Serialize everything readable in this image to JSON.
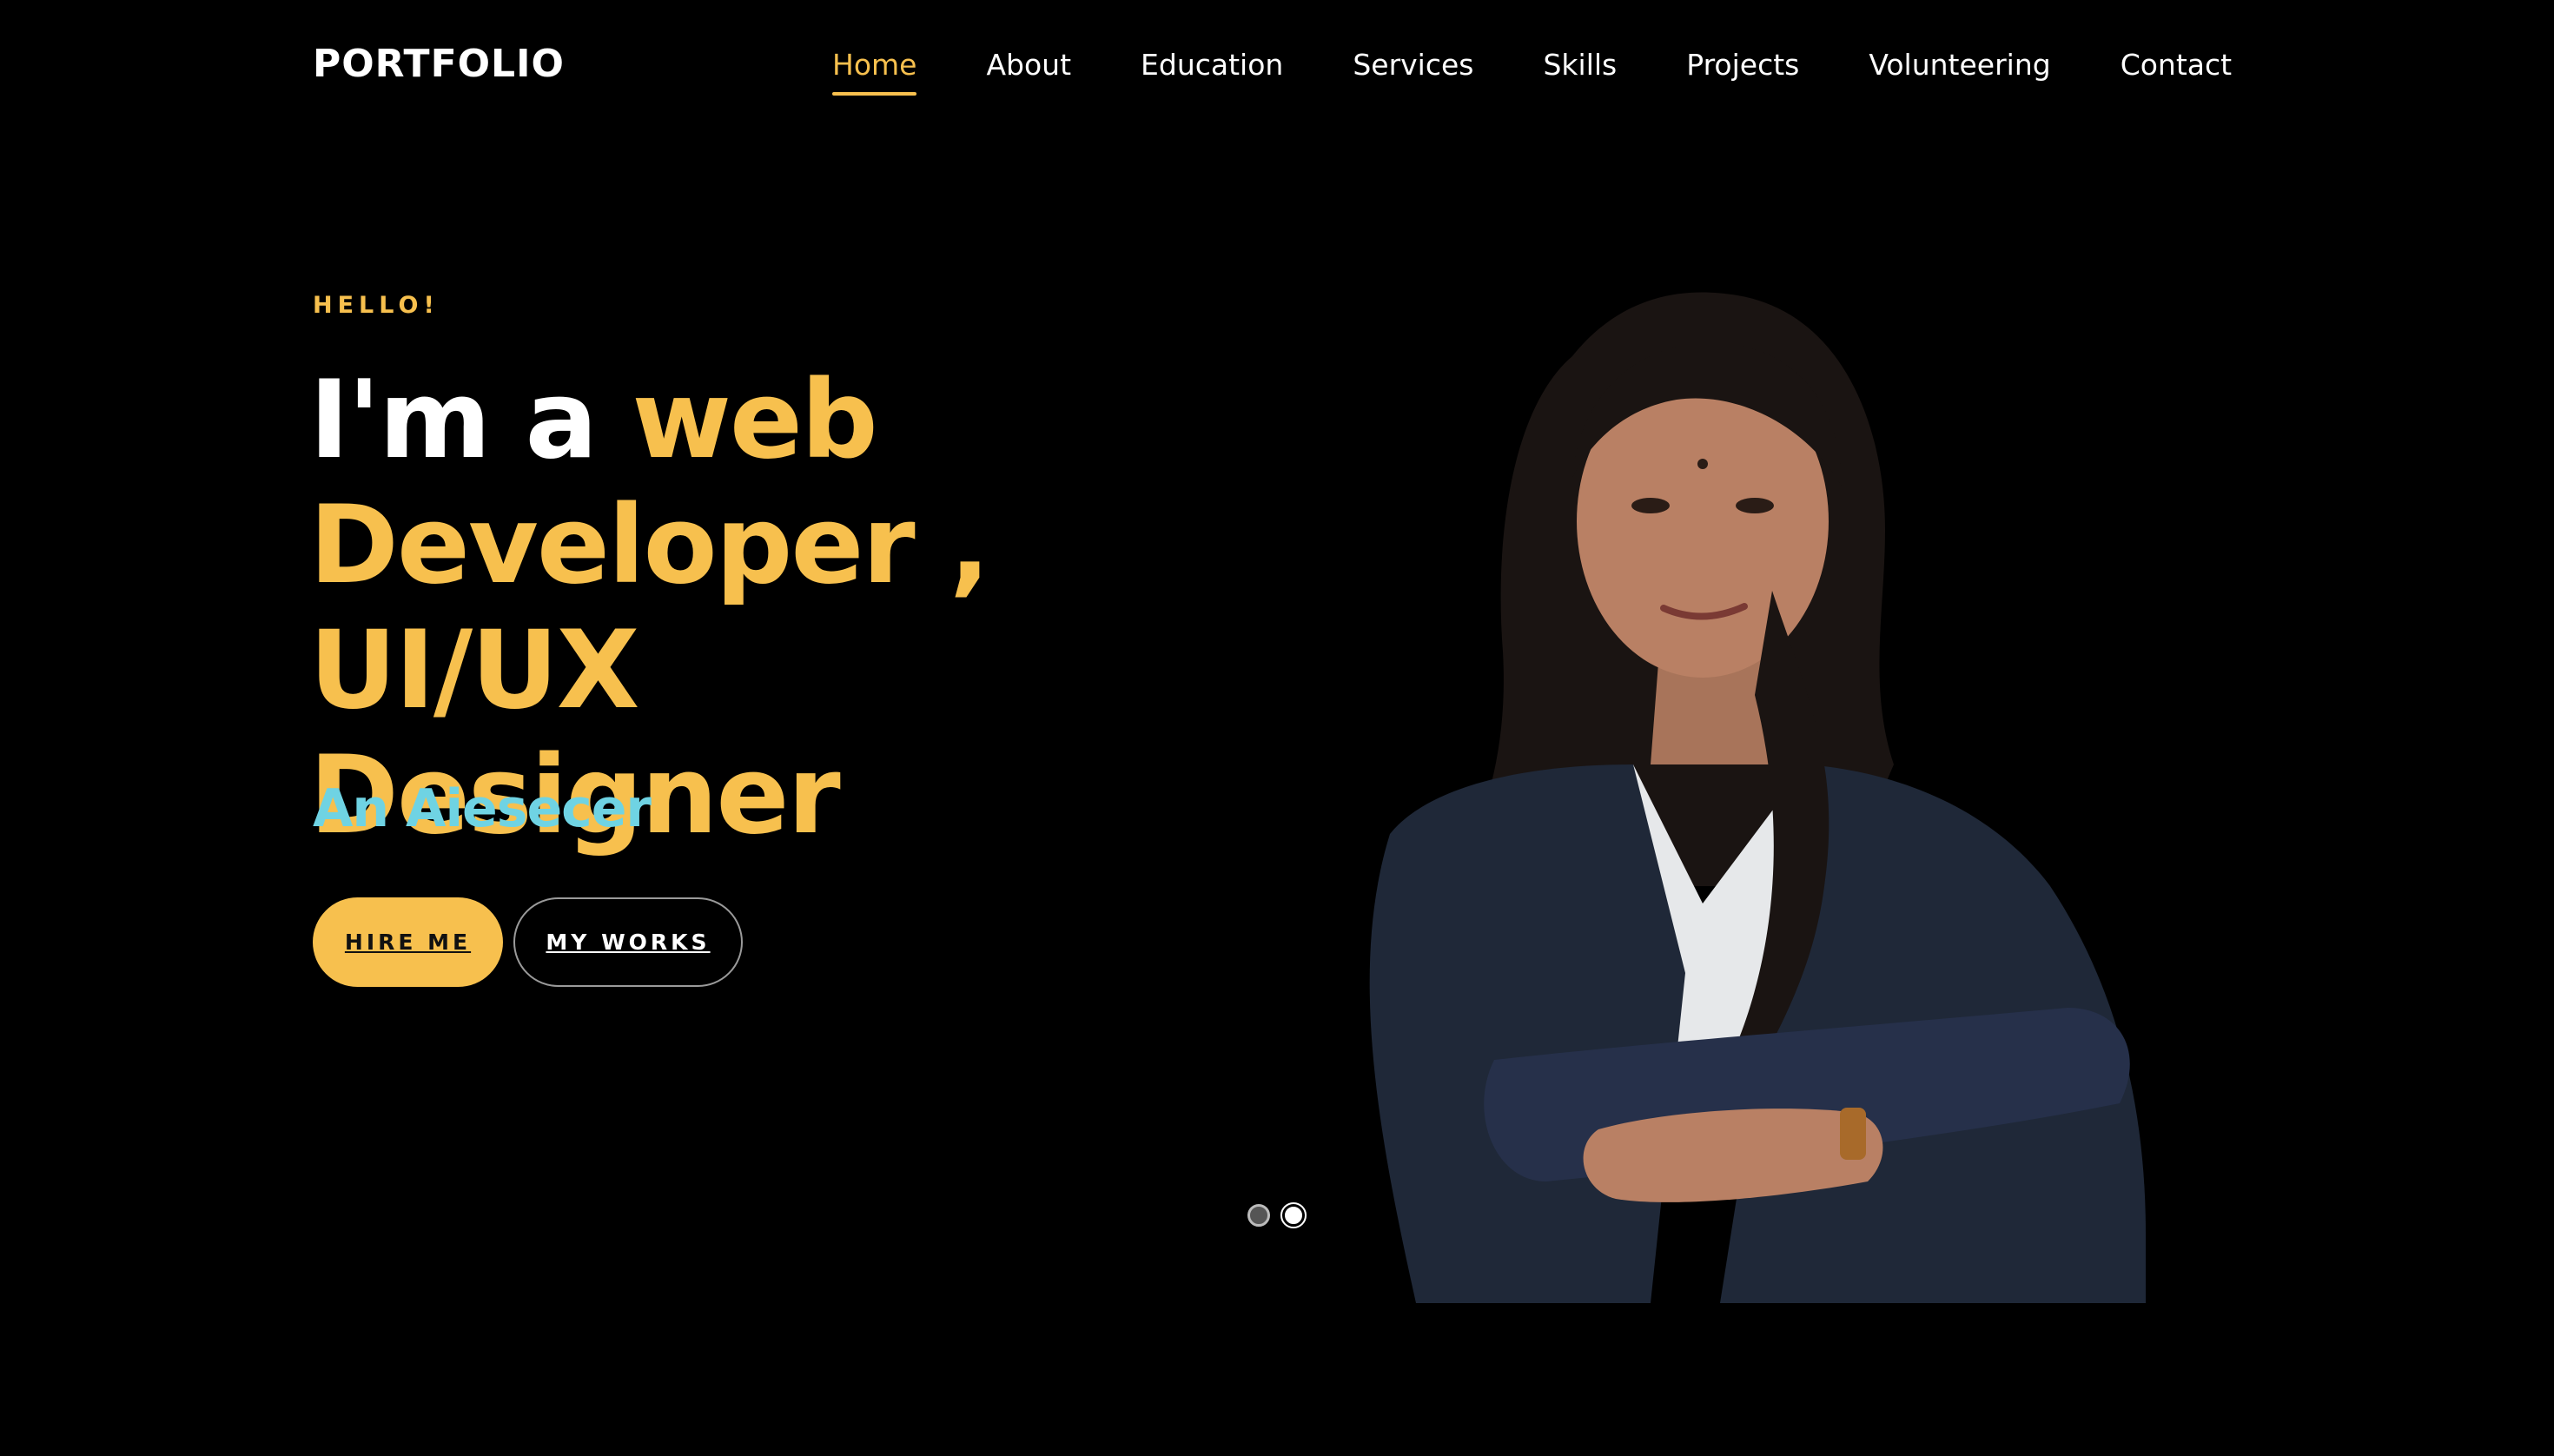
{
  "brand": {
    "logo": "PORTFOLIO"
  },
  "nav": {
    "items": [
      {
        "label": "Home"
      },
      {
        "label": "About"
      },
      {
        "label": "Education"
      },
      {
        "label": "Services"
      },
      {
        "label": "Skills"
      },
      {
        "label": "Projects"
      },
      {
        "label": "Volunteering"
      },
      {
        "label": "Contact"
      }
    ],
    "active": "Home"
  },
  "hero": {
    "eyebrow": "HELLO!",
    "headline_prefix": "I'm a ",
    "headline_highlight_1": "web",
    "headline_highlight_2": "Developer ,",
    "headline_highlight_3": "UI/UX Designer",
    "tagline": "An Aiesecer",
    "hire_button": "HIRE ME",
    "works_button": "MY WORKS"
  },
  "slider": {
    "slides": 2,
    "active_index": 2
  },
  "colors": {
    "accent": "#f7c04e",
    "tagline": "#6fd3e3",
    "background": "#000000",
    "text": "#ffffff"
  },
  "icons": {
    "portrait": "person-photo"
  }
}
